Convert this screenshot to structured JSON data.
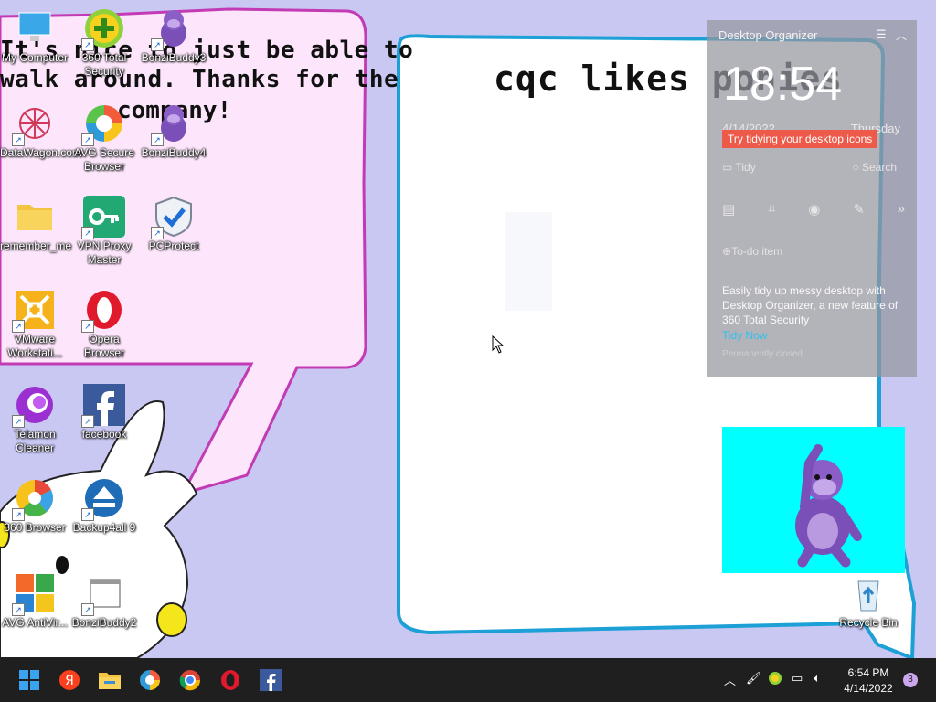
{
  "wallpaper": {
    "bubble_lines": [
      "It's nice to just be able to",
      "walk around. Thanks for the",
      "company!"
    ],
    "board_text": "cqc likes ponies"
  },
  "desktop_icons": [
    {
      "label": "My Computer",
      "icon": "monitor-icon"
    },
    {
      "label": "360 Total Security",
      "icon": "360-total-security-icon"
    },
    {
      "label": "BonziBuddy3",
      "icon": "bonzibuddy-icon"
    },
    {
      "label": "DataWagon.com",
      "icon": "datawagon-icon"
    },
    {
      "label": "AVG Secure Browser",
      "icon": "avg-secure-browser-icon"
    },
    {
      "label": "BonziBuddy4",
      "icon": "bonzibuddy-icon"
    },
    {
      "label": "remember_me",
      "icon": "folder-icon"
    },
    {
      "label": "VPN Proxy Master",
      "icon": "vpn-key-icon"
    },
    {
      "label": "PCProtect",
      "icon": "shield-check-icon"
    },
    {
      "label": "VMware Workstati...",
      "icon": "vmware-icon"
    },
    {
      "label": "Opera Browser",
      "icon": "opera-icon"
    },
    {
      "label": "Telamon Cleaner",
      "icon": "telamon-icon"
    },
    {
      "label": "facebook",
      "icon": "facebook-icon"
    },
    {
      "label": "360 Browser",
      "icon": "360-browser-icon"
    },
    {
      "label": "Backup4all 9",
      "icon": "backup-icon"
    },
    {
      "label": "AVG AntiVir...",
      "icon": "avg-antivirus-icon"
    },
    {
      "label": "BonziBuddy2",
      "icon": "window-file-icon"
    },
    {
      "label": "Recycle Bin",
      "icon": "recycle-bin-icon"
    }
  ],
  "organizer": {
    "title": "Desktop Organizer",
    "clock": "18:54",
    "date": "4/14/2022",
    "weekday": "Thursday",
    "tip": "Try tidying your desktop icons",
    "tidy_label": "Tidy",
    "search_label": "Search",
    "todo_label": "To-do item",
    "description": "Easily tidy up messy desktop with Desktop Organizer, a new feature of 360 Total Security",
    "tidy_now": "Tidy Now",
    "permanently_closed": "Permanently closed"
  },
  "taskbar": {
    "apps": [
      "start-icon",
      "yandex-icon",
      "file-explorer-icon",
      "avg-secure-browser-icon",
      "chrome-icon",
      "opera-icon",
      "facebook-icon"
    ],
    "time": "6:54 PM",
    "date": "4/14/2022",
    "notification_count": "3"
  },
  "colors": {
    "wallpaper": "#c9c8f3",
    "taskbar": "#1f1f1f",
    "organizer_tip": "#ee5a4a",
    "organizer_link": "#2fc0f0",
    "bonzi_background": "#00ffff"
  }
}
